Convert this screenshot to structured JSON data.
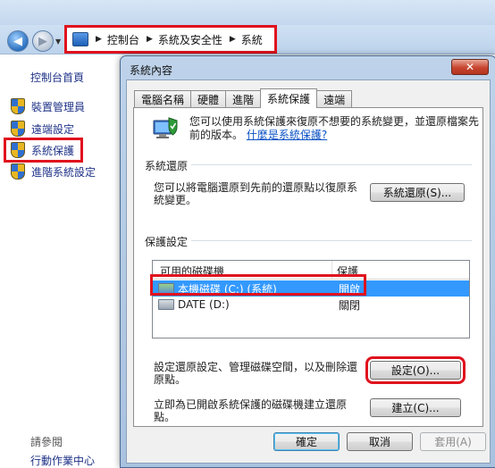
{
  "explorer": {
    "breadcrumb": [
      "控制台",
      "系統及安全性",
      "系統"
    ],
    "sidebar": {
      "home": "控制台首頁",
      "items": [
        {
          "label": "裝置管理員",
          "icon": "shield-icon"
        },
        {
          "label": "遠端設定",
          "icon": "shield-icon"
        },
        {
          "label": "系統保護",
          "icon": "shield-icon"
        },
        {
          "label": "進階系統設定",
          "icon": "shield-icon"
        }
      ],
      "see_also": "請參閱",
      "see_also_item": "行動作業中心"
    }
  },
  "dialog": {
    "title": "系統內容",
    "close": "✕",
    "tabs": [
      "電腦名稱",
      "硬體",
      "進階",
      "系統保護",
      "遠端"
    ],
    "active_tab": "系統保護",
    "intro": "您可以使用系統保護來復原不想要的系統變更，並還原檔案先前的版本。",
    "intro_link": "什麼是系統保護?",
    "restore_group": "系統還原",
    "restore_text": "您可以將電腦還原到先前的還原點以復原系統變更。",
    "restore_button": "系統還原(S)...",
    "protection_group": "保護設定",
    "list_headers": [
      "可用的磁碟機",
      "保護"
    ],
    "drives": [
      {
        "name": "本機磁碟 (C:) (系統)",
        "state": "開啟",
        "selected": true
      },
      {
        "name": "DATE (D:)",
        "state": "關閉",
        "selected": false
      }
    ],
    "configure_text": "設定還原設定、管理磁碟空間，以及刪除還原點。",
    "configure_button": "設定(O)...",
    "create_text": "立即為已開啟系統保護的磁碟機建立還原點。",
    "create_button": "建立(C)...",
    "ok": "確定",
    "cancel": "取消",
    "apply": "套用(A)"
  }
}
